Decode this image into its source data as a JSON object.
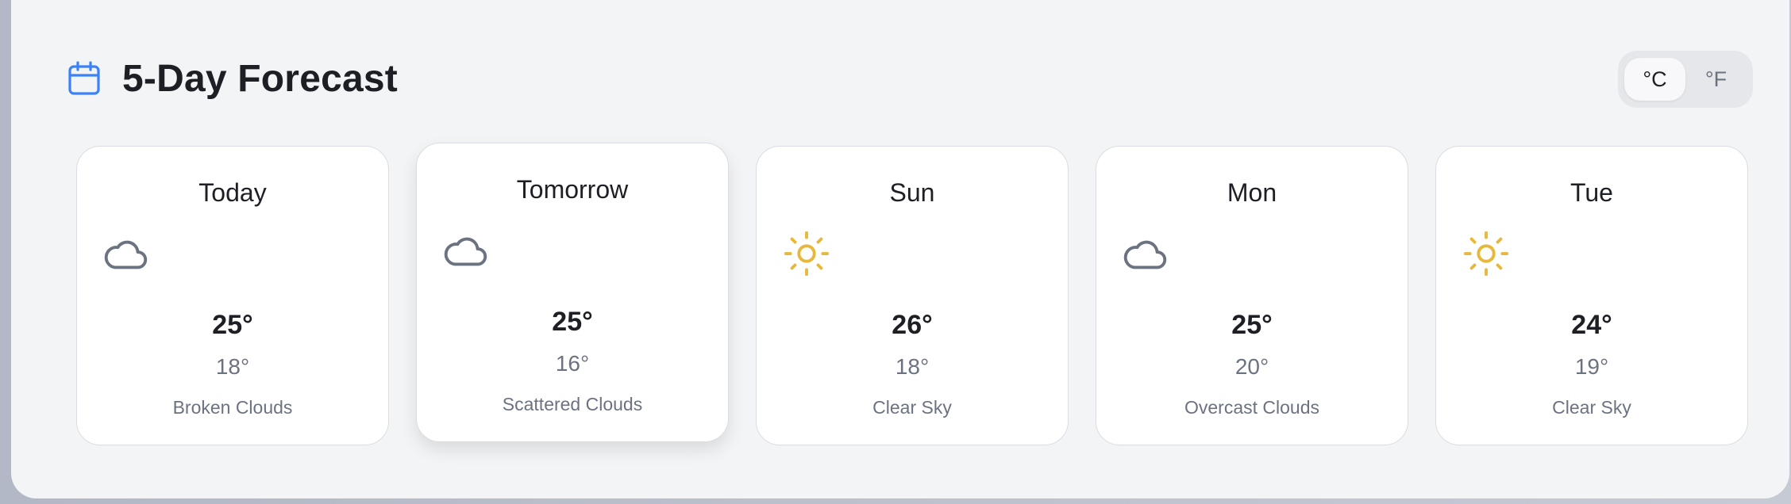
{
  "header": {
    "title": "5-Day Forecast",
    "icon": "calendar-icon",
    "accent": "#3b82f6"
  },
  "units": {
    "celsius_label": "°C",
    "fahrenheit_label": "°F",
    "selected": "°C"
  },
  "forecast": [
    {
      "day": "Today",
      "icon": "cloud-icon",
      "high": "25°",
      "low": "18°",
      "description": "Broken Clouds"
    },
    {
      "day": "Tomorrow",
      "icon": "cloud-icon",
      "high": "25°",
      "low": "16°",
      "description": "Scattered Clouds"
    },
    {
      "day": "Sun",
      "icon": "sun-icon",
      "high": "26°",
      "low": "18°",
      "description": "Clear Sky"
    },
    {
      "day": "Mon",
      "icon": "cloud-icon",
      "high": "25°",
      "low": "20°",
      "description": "Overcast Clouds"
    },
    {
      "day": "Tue",
      "icon": "sun-icon",
      "high": "24°",
      "low": "19°",
      "description": "Clear Sky"
    }
  ],
  "colors": {
    "cloud": "#6b7280",
    "sun": "#e8b83c"
  }
}
